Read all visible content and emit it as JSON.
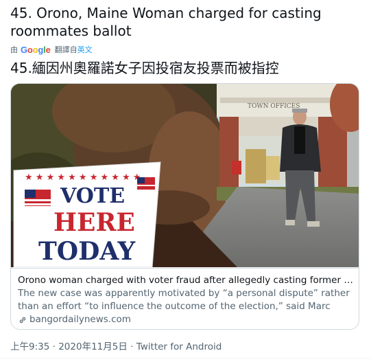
{
  "tweet": {
    "text": "45. Orono, Maine Woman charged for casting roommates ballot",
    "translation": {
      "by_label": "由",
      "provider": "Google",
      "action_label": "翻譯自",
      "source_language": "英文",
      "text": "45.緬因州奧羅諾女子因投宿友投票而被指控"
    },
    "card": {
      "image_alt": "Vote Here Today sign outside Town Offices",
      "sign_lines": [
        "VOTE",
        "HERE",
        "TODAY"
      ],
      "building_sign": "TOWN OFFICES",
      "title": "Orono woman charged with voter fraud after allegedly casting former room...",
      "description": "The new case was apparently motivated by “a personal dispute” rather than an effort “to influence the outcome of the election,” said Marc Malon, a ...",
      "domain": "bangordailynews.com"
    },
    "meta": {
      "time": "上午9:35",
      "separator": "·",
      "date": "2020年11月5日",
      "client": "Twitter for Android"
    }
  },
  "colors": {
    "text": "#0f1419",
    "secondary": "#536471",
    "link": "#1d9bf0",
    "border": "#cfd9de",
    "sign_red": "#c8262f",
    "sign_blue": "#1f2f6b"
  }
}
